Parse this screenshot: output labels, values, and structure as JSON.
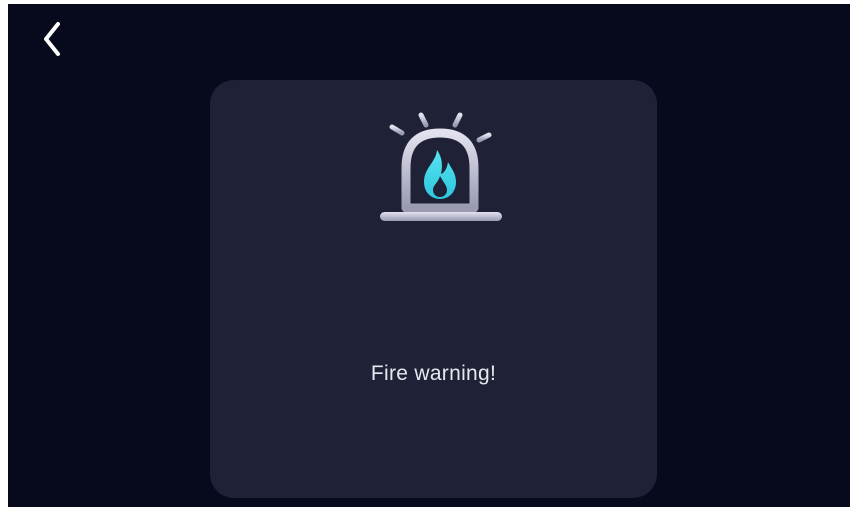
{
  "header": {
    "back_icon": "chevron-left-icon"
  },
  "alert": {
    "icon": "fire-alarm-siren-icon",
    "message": "Fire warning!"
  },
  "colors": {
    "background": "#070a1c",
    "card": "#1f2236",
    "flame": "#3ed6e8",
    "siren": "#c9c9dd",
    "text": "#e6e8ef"
  }
}
